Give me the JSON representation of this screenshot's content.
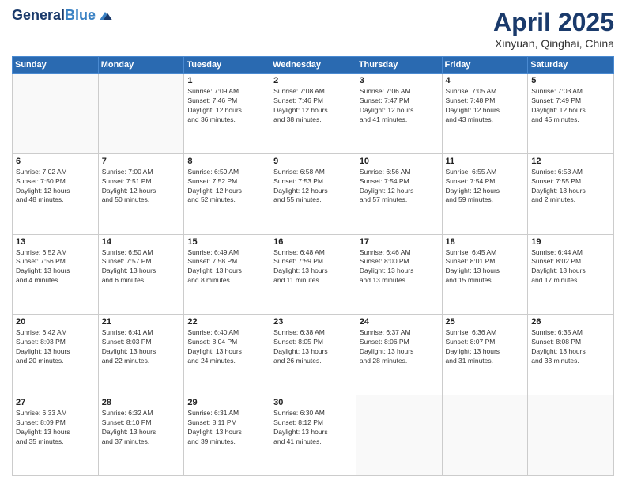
{
  "header": {
    "logo_line1": "General",
    "logo_line2": "Blue",
    "month_title": "April 2025",
    "location": "Xinyuan, Qinghai, China"
  },
  "weekdays": [
    "Sunday",
    "Monday",
    "Tuesday",
    "Wednesday",
    "Thursday",
    "Friday",
    "Saturday"
  ],
  "weeks": [
    [
      {
        "day": "",
        "info": ""
      },
      {
        "day": "",
        "info": ""
      },
      {
        "day": "1",
        "info": "Sunrise: 7:09 AM\nSunset: 7:46 PM\nDaylight: 12 hours\nand 36 minutes."
      },
      {
        "day": "2",
        "info": "Sunrise: 7:08 AM\nSunset: 7:46 PM\nDaylight: 12 hours\nand 38 minutes."
      },
      {
        "day": "3",
        "info": "Sunrise: 7:06 AM\nSunset: 7:47 PM\nDaylight: 12 hours\nand 41 minutes."
      },
      {
        "day": "4",
        "info": "Sunrise: 7:05 AM\nSunset: 7:48 PM\nDaylight: 12 hours\nand 43 minutes."
      },
      {
        "day": "5",
        "info": "Sunrise: 7:03 AM\nSunset: 7:49 PM\nDaylight: 12 hours\nand 45 minutes."
      }
    ],
    [
      {
        "day": "6",
        "info": "Sunrise: 7:02 AM\nSunset: 7:50 PM\nDaylight: 12 hours\nand 48 minutes."
      },
      {
        "day": "7",
        "info": "Sunrise: 7:00 AM\nSunset: 7:51 PM\nDaylight: 12 hours\nand 50 minutes."
      },
      {
        "day": "8",
        "info": "Sunrise: 6:59 AM\nSunset: 7:52 PM\nDaylight: 12 hours\nand 52 minutes."
      },
      {
        "day": "9",
        "info": "Sunrise: 6:58 AM\nSunset: 7:53 PM\nDaylight: 12 hours\nand 55 minutes."
      },
      {
        "day": "10",
        "info": "Sunrise: 6:56 AM\nSunset: 7:54 PM\nDaylight: 12 hours\nand 57 minutes."
      },
      {
        "day": "11",
        "info": "Sunrise: 6:55 AM\nSunset: 7:54 PM\nDaylight: 12 hours\nand 59 minutes."
      },
      {
        "day": "12",
        "info": "Sunrise: 6:53 AM\nSunset: 7:55 PM\nDaylight: 13 hours\nand 2 minutes."
      }
    ],
    [
      {
        "day": "13",
        "info": "Sunrise: 6:52 AM\nSunset: 7:56 PM\nDaylight: 13 hours\nand 4 minutes."
      },
      {
        "day": "14",
        "info": "Sunrise: 6:50 AM\nSunset: 7:57 PM\nDaylight: 13 hours\nand 6 minutes."
      },
      {
        "day": "15",
        "info": "Sunrise: 6:49 AM\nSunset: 7:58 PM\nDaylight: 13 hours\nand 8 minutes."
      },
      {
        "day": "16",
        "info": "Sunrise: 6:48 AM\nSunset: 7:59 PM\nDaylight: 13 hours\nand 11 minutes."
      },
      {
        "day": "17",
        "info": "Sunrise: 6:46 AM\nSunset: 8:00 PM\nDaylight: 13 hours\nand 13 minutes."
      },
      {
        "day": "18",
        "info": "Sunrise: 6:45 AM\nSunset: 8:01 PM\nDaylight: 13 hours\nand 15 minutes."
      },
      {
        "day": "19",
        "info": "Sunrise: 6:44 AM\nSunset: 8:02 PM\nDaylight: 13 hours\nand 17 minutes."
      }
    ],
    [
      {
        "day": "20",
        "info": "Sunrise: 6:42 AM\nSunset: 8:03 PM\nDaylight: 13 hours\nand 20 minutes."
      },
      {
        "day": "21",
        "info": "Sunrise: 6:41 AM\nSunset: 8:03 PM\nDaylight: 13 hours\nand 22 minutes."
      },
      {
        "day": "22",
        "info": "Sunrise: 6:40 AM\nSunset: 8:04 PM\nDaylight: 13 hours\nand 24 minutes."
      },
      {
        "day": "23",
        "info": "Sunrise: 6:38 AM\nSunset: 8:05 PM\nDaylight: 13 hours\nand 26 minutes."
      },
      {
        "day": "24",
        "info": "Sunrise: 6:37 AM\nSunset: 8:06 PM\nDaylight: 13 hours\nand 28 minutes."
      },
      {
        "day": "25",
        "info": "Sunrise: 6:36 AM\nSunset: 8:07 PM\nDaylight: 13 hours\nand 31 minutes."
      },
      {
        "day": "26",
        "info": "Sunrise: 6:35 AM\nSunset: 8:08 PM\nDaylight: 13 hours\nand 33 minutes."
      }
    ],
    [
      {
        "day": "27",
        "info": "Sunrise: 6:33 AM\nSunset: 8:09 PM\nDaylight: 13 hours\nand 35 minutes."
      },
      {
        "day": "28",
        "info": "Sunrise: 6:32 AM\nSunset: 8:10 PM\nDaylight: 13 hours\nand 37 minutes."
      },
      {
        "day": "29",
        "info": "Sunrise: 6:31 AM\nSunset: 8:11 PM\nDaylight: 13 hours\nand 39 minutes."
      },
      {
        "day": "30",
        "info": "Sunrise: 6:30 AM\nSunset: 8:12 PM\nDaylight: 13 hours\nand 41 minutes."
      },
      {
        "day": "",
        "info": ""
      },
      {
        "day": "",
        "info": ""
      },
      {
        "day": "",
        "info": ""
      }
    ]
  ]
}
